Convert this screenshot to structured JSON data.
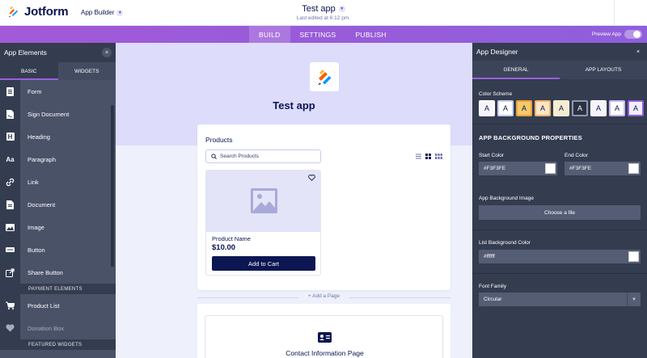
{
  "header": {
    "brand": "Jotform",
    "builder_select": "App Builder",
    "app_title": "Test app",
    "last_edited": "Last edited at 6:12 pm."
  },
  "nav": {
    "tabs": [
      {
        "label": "BUILD",
        "active": true
      },
      {
        "label": "SETTINGS",
        "active": false
      },
      {
        "label": "PUBLISH",
        "active": false
      }
    ],
    "preview_label": "Preview App"
  },
  "left_panel": {
    "title": "App Elements",
    "close": "×",
    "tabs": [
      {
        "label": "BASIC",
        "active": true
      },
      {
        "label": "WIDGETS",
        "active": false
      }
    ],
    "items": [
      {
        "label": "Form",
        "icon": "form-icon"
      },
      {
        "label": "Sign Document",
        "icon": "sign-document-icon"
      },
      {
        "label": "Heading",
        "icon": "heading-icon"
      },
      {
        "label": "Paragraph",
        "icon": "paragraph-icon"
      },
      {
        "label": "Link",
        "icon": "link-icon"
      },
      {
        "label": "Document",
        "icon": "document-icon"
      },
      {
        "label": "Image",
        "icon": "image-icon"
      },
      {
        "label": "Button",
        "icon": "button-icon"
      },
      {
        "label": "Share Button",
        "icon": "share-icon"
      }
    ],
    "payment_section": "PAYMENT ELEMENTS",
    "payment_items": [
      {
        "label": "Product List",
        "icon": "cart-icon"
      },
      {
        "label": "Donation Box",
        "icon": "heart-icon"
      }
    ],
    "featured_section": "FEATURED WIDGETS",
    "heading_glyph": "H",
    "paragraph_glyph": "Aa"
  },
  "canvas": {
    "app_name": "Test app",
    "products_title": "Products",
    "search_placeholder": "Search Products",
    "product_name": "Product Name",
    "product_price": "$10.00",
    "add_to_cart": "Add to Cart",
    "add_page": "+ Add a Page",
    "contact_page": "Contact Information Page"
  },
  "right_panel": {
    "title": "App Designer",
    "close": "×",
    "tabs": [
      {
        "label": "GENERAL",
        "active": true
      },
      {
        "label": "APP LAYOUTS",
        "active": false
      }
    ],
    "color_scheme_label": "Color Scheme",
    "swatches": [
      {
        "letter": "A",
        "bg": "#f6f6f9",
        "fg": "#0a1551",
        "border": "#ffffff"
      },
      {
        "letter": "A",
        "bg": "#ffffff",
        "fg": "#0a1551",
        "border": "#c8ceed"
      },
      {
        "letter": "A",
        "bg": "#f6c96b",
        "fg": "#0a1551",
        "border": "#e8a33a"
      },
      {
        "letter": "A",
        "bg": "#fde6c8",
        "fg": "#0a1551",
        "border": "#f0b36a"
      },
      {
        "letter": "A",
        "bg": "#f6ecd2",
        "fg": "#0a1551",
        "border": "#f6ecd2"
      },
      {
        "letter": "A",
        "bg": "#2a3142",
        "fg": "#ffffff",
        "border": "#8f96ad"
      },
      {
        "letter": "A",
        "bg": "#f4f4f9",
        "fg": "#0a1551",
        "border": "#ffffff"
      },
      {
        "letter": "A",
        "bg": "#ffffff",
        "fg": "#0a1551",
        "border": "#c5b8f0"
      },
      {
        "letter": "A",
        "bg": "#f2eefd",
        "fg": "#0a1551",
        "border": "#8f5fdc"
      }
    ],
    "bg_properties_label": "APP BACKGROUND PROPERTIES",
    "start_color_label": "Start Color",
    "start_color_value": "#F3F3FE",
    "end_color_label": "End Color",
    "end_color_value": "#F3F3FE",
    "bg_image_label": "App Background Image",
    "choose_file": "Choose a file",
    "list_bg_label": "List Background Color",
    "list_bg_value": "#ffffff",
    "font_family_label": "Font Family",
    "font_family_value": "Circular"
  }
}
